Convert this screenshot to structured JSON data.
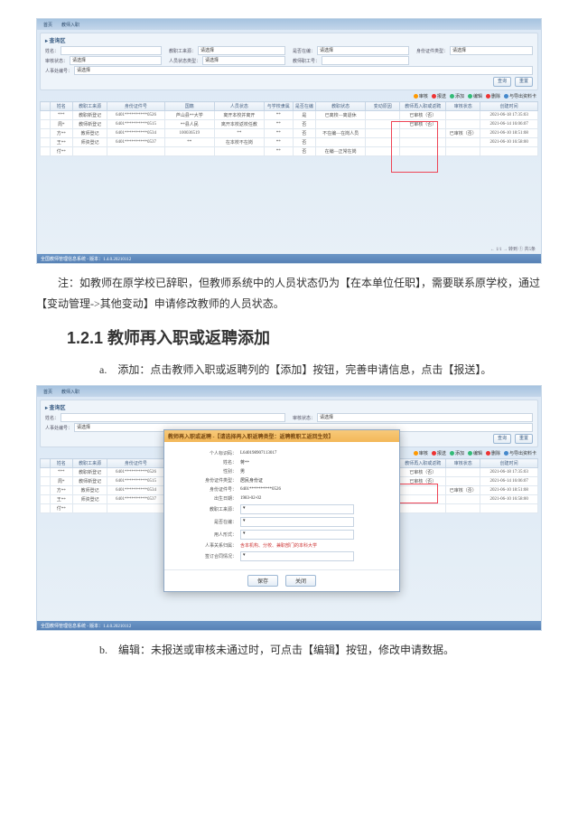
{
  "screenshot1": {
    "tabs": [
      "首页",
      "教师入职"
    ],
    "search": {
      "title": "▸ 查询区",
      "fields": {
        "xm_l": "姓名：",
        "xm_ph": "请输入",
        "jgst_l": "教职工来源：",
        "jgst_v": "请选择",
        "sfzt_l": "身份证件类型：",
        "sfzt_v": "请选择",
        "sflx_l": "是否在编：",
        "sflx_v": "请选择",
        "shzt_l": "审核状态：",
        "shzt_v": "请选择",
        "rybh_l": "人事处编号：",
        "rybh_v": "请选择",
        "rzzt_l": "人员状态类型：",
        "rzzt_v": "请选择",
        "rzsj_l": "教师职工号：",
        "rzsj_v": ""
      },
      "btn_query": "查询",
      "btn_reset": "重置"
    },
    "toolbar": {
      "review": "审核",
      "submit": "报送",
      "add": "添加",
      "edit": "编辑",
      "del": "删除",
      "more": "与导出资料卡"
    },
    "columns": [
      "",
      "姓名",
      "教职工来源",
      "身份证件号",
      "国籍",
      "人员状态",
      "与学校隶属",
      "是否在编",
      "教职状态",
      "变动原因",
      "教师再入职或返聘",
      "审核状态",
      "创建时间"
    ],
    "rows": [
      [
        "",
        "***",
        "教职新登记",
        "6401**********0526",
        "芦山县**大学",
        "离开本校并离开",
        "**",
        "是",
        "已离校—离退休",
        "",
        "已审核（否）",
        "",
        "2021-06-18 17:35:03"
      ],
      [
        "",
        "周*",
        "教师新登记",
        "6401**********0515",
        "**县人民",
        "离开本校返校任教",
        "**",
        "否",
        "",
        "",
        "已审核（否）",
        "",
        "2021-06-14 16:06:07"
      ],
      [
        "",
        "方**",
        "教师登记",
        "6401**********0534",
        "100036519",
        "**",
        "**",
        "否",
        "不在编—在岗人员",
        "",
        "",
        "已审核（否）",
        "2021-06-10 18:51:08"
      ],
      [
        "",
        "王**",
        "师资登记",
        "6401**********0537",
        "**",
        "在本校不在岗",
        "**",
        "否",
        "",
        "",
        "",
        "",
        "2021-06-10 16:58:00"
      ],
      [
        "",
        "付**",
        "",
        "",
        "",
        "",
        "**",
        "否",
        "在编—正常在岗",
        "",
        "",
        "",
        ""
      ]
    ],
    "pager": "← 1/1 → 转到 ① 共5条",
    "footer": "全国教师管理信息系统 - 版本：1.4.0.20210112"
  },
  "note": "注：如教师在原学校已辞职，但教师系统中的人员状态仍为【在本单位任职】，需要联系原学校，通过【变动管理->其他变动】申请修改教师的人员状态。",
  "heading": "1.2.1 教师再入职或返聘添加",
  "itemA": "a.　添加：点击教师入职或返聘列的【添加】按钮，完善申请信息，点击【报送】。",
  "itemB": "b.　编辑：未报送或审核未通过时，可点击【编辑】按钮，修改申请数据。",
  "screenshot2": {
    "modal": {
      "title": "教师再入职或返聘 -【请选择再入职返聘类型：返聘教职工返回生效】",
      "rows": {
        "zzh_l": "个人标识码：",
        "zzh_v": "L640198907113017",
        "xm_l": "姓名：",
        "xm_v": "蒋**",
        "xb_l": "性别：",
        "xb_v": "男",
        "zjlx_l": "身份证件类型：",
        "zjlx_v": "居民身份证",
        "zjh_l": "身份证件号：",
        "zjh_v": "6401**********0526",
        "csrq_l": "出生日期：",
        "csrq_v": "1983-02-02",
        "gzny_l": "教职工来源：",
        "gzny_v": "",
        "sfzb_l": "是否在编：",
        "sfzb_v": "",
        "yzbm_l": "用人形式：",
        "yzbm_v": "",
        "rybh_l": "人事关系归属：",
        "rybh_v": "含本机构、分校、兼职部门的本科大学",
        "bz_l": "签订合同情况：",
        "bz_v": ""
      },
      "btn_save": "保存",
      "btn_close": "关闭"
    }
  }
}
